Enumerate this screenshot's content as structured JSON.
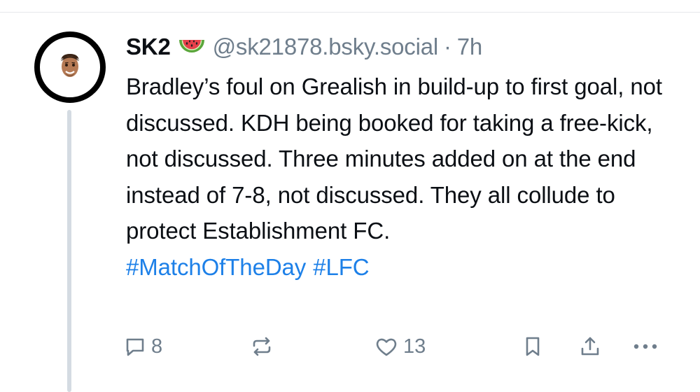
{
  "post": {
    "display_name": "SK2",
    "name_emoji_icon": "watermelon-icon",
    "handle": "@sk21878.bsky.social",
    "separator": "·",
    "time": "7h",
    "avatar_icon": "memoji-face-icon",
    "text": "Bradley’s foul on Grealish in build-up to first goal, not discussed. KDH being booked for taking a free-kick, not discussed. Three minutes added on at the end instead of 7-8, not discussed. They all collude to protect Establishment FC.",
    "hashtags": [
      "#MatchOfTheDay",
      "#LFC"
    ]
  },
  "actions": {
    "reply": {
      "icon": "reply-bubble-icon",
      "count": "8"
    },
    "repost": {
      "icon": "repost-icon"
    },
    "like": {
      "icon": "heart-icon",
      "count": "13"
    },
    "bookmark": {
      "icon": "bookmark-icon"
    },
    "share": {
      "icon": "share-icon"
    },
    "more": {
      "icon": "more-dots-icon"
    }
  },
  "colors": {
    "text": "#0b0f14",
    "muted": "#6f7e8c",
    "link": "#1d80e8",
    "thread_line": "#d4dbe2"
  }
}
